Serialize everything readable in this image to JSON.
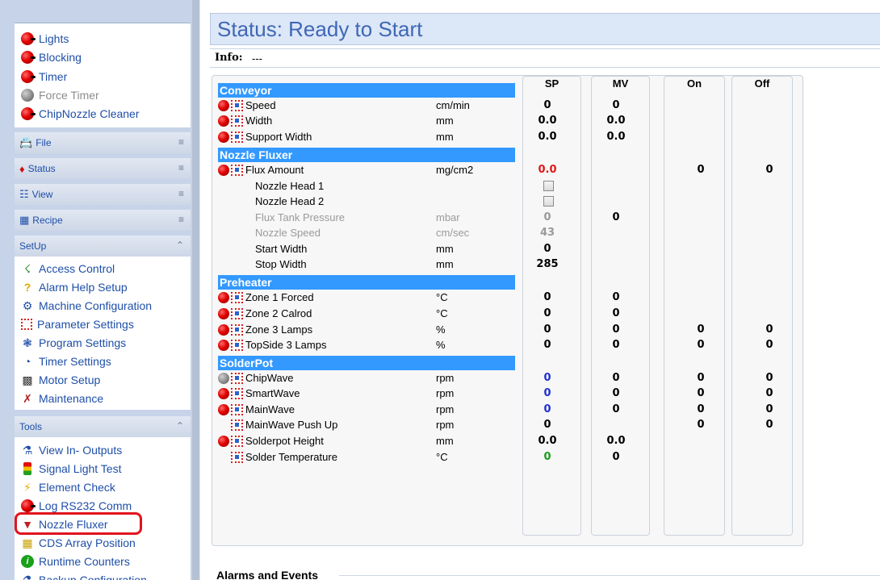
{
  "sidebar": {
    "top_items": [
      {
        "label": "Lights",
        "icon": "red-ball-icon",
        "enabled": true
      },
      {
        "label": "Blocking",
        "icon": "red-ball-icon",
        "enabled": true
      },
      {
        "label": "Timer",
        "icon": "red-ball-icon",
        "enabled": true
      },
      {
        "label": "Force Timer",
        "icon": "gray-ball-icon",
        "enabled": false
      },
      {
        "label": "ChipNozzle Cleaner",
        "icon": "red-ball-icon",
        "enabled": true
      }
    ],
    "groups": {
      "file": "File",
      "status": "Status",
      "view": "View",
      "recipe": "Recipe",
      "setup": "SetUp",
      "tools": "Tools"
    },
    "setup_items": [
      {
        "label": "Access Control",
        "icon": "key-people-icon"
      },
      {
        "label": "Alarm Help Setup",
        "icon": "question-icon"
      },
      {
        "label": "Machine Configuration",
        "icon": "machine-icon"
      },
      {
        "label": "Parameter Settings",
        "icon": "parameter-icon"
      },
      {
        "label": "Program Settings",
        "icon": "program-icon"
      },
      {
        "label": "Timer Settings",
        "icon": "clock-icon"
      },
      {
        "label": "Motor Setup",
        "icon": "motor-icon"
      },
      {
        "label": "Maintenance",
        "icon": "tools-icon"
      }
    ],
    "tools_items": [
      {
        "label": "View In- Outputs",
        "icon": "io-icon"
      },
      {
        "label": "Signal Light Test",
        "icon": "signal-light-icon"
      },
      {
        "label": "Element Check",
        "icon": "lightning-icon"
      },
      {
        "label": "Log RS232 Comm",
        "icon": "red-ball-icon"
      },
      {
        "label": "Nozzle Fluxer",
        "icon": "nozzle-icon"
      },
      {
        "label": "CDS Array Position",
        "icon": "grid-icon"
      },
      {
        "label": "Runtime Counters",
        "icon": "info-icon"
      },
      {
        "label": "Backup Configuration",
        "icon": "backup-icon"
      }
    ]
  },
  "status": {
    "title": "Status: Ready to Start"
  },
  "info": {
    "label": "Info:",
    "value": "---"
  },
  "columns": {
    "sp": "SP",
    "mv": "MV",
    "on": "On",
    "off": "Off"
  },
  "sections": {
    "conveyor": "Conveyor",
    "nozzle_fluxer": "Nozzle Fluxer",
    "preheater": "Preheater",
    "solderpot": "SolderPot"
  },
  "rows": {
    "speed": {
      "label": "Speed",
      "unit": "cm/min",
      "sp": "0",
      "mv": "0"
    },
    "width": {
      "label": "Width",
      "unit": "mm",
      "sp": "0.0",
      "mv": "0.0"
    },
    "support_width": {
      "label": "Support Width",
      "unit": "mm",
      "sp": "0.0",
      "mv": "0.0"
    },
    "flux_amount": {
      "label": "Flux Amount",
      "unit": "mg/cm2",
      "sp": "0.0",
      "on": "0",
      "off": "0"
    },
    "nozzle_head_1": {
      "label": "Nozzle Head 1"
    },
    "nozzle_head_2": {
      "label": "Nozzle Head 2"
    },
    "flux_tank_pressure": {
      "label": "Flux Tank Pressure",
      "unit": "mbar",
      "sp": "0",
      "mv": "0"
    },
    "nozzle_speed": {
      "label": "Nozzle Speed",
      "unit": "cm/sec",
      "sp": "43"
    },
    "start_width": {
      "label": "Start Width",
      "unit": "mm",
      "sp": "0"
    },
    "stop_width": {
      "label": "Stop Width",
      "unit": "mm",
      "sp": "285"
    },
    "zone1": {
      "label": "Zone 1 Forced",
      "unit": "°C",
      "sp": "0",
      "mv": "0"
    },
    "zone2": {
      "label": "Zone 2 Calrod",
      "unit": "°C",
      "sp": "0",
      "mv": "0"
    },
    "zone3": {
      "label": "Zone 3 Lamps",
      "unit": "%",
      "sp": "0",
      "mv": "0",
      "on": "0",
      "off": "0"
    },
    "topside3": {
      "label": "TopSide 3 Lamps",
      "unit": "%",
      "sp": "0",
      "mv": "0",
      "on": "0",
      "off": "0"
    },
    "chipwave": {
      "label": "ChipWave",
      "unit": "rpm",
      "sp": "0",
      "mv": "0",
      "on": "0",
      "off": "0"
    },
    "smartwave": {
      "label": "SmartWave",
      "unit": "rpm",
      "sp": "0",
      "mv": "0",
      "on": "0",
      "off": "0"
    },
    "mainwave": {
      "label": "MainWave",
      "unit": "rpm",
      "sp": "0",
      "mv": "0",
      "on": "0",
      "off": "0"
    },
    "mainwave_pushup": {
      "label": "MainWave Push Up",
      "unit": "rpm",
      "sp": "0",
      "on": "0",
      "off": "0"
    },
    "solderpot_height": {
      "label": "Solderpot Height",
      "unit": "mm",
      "sp": "0.0",
      "mv": "0.0"
    },
    "solder_temp": {
      "label": "Solder Temperature",
      "unit": "°C",
      "sp": "0",
      "mv": "0"
    }
  },
  "alarms": {
    "title": "Alarms and Events"
  },
  "colors": {
    "section_bar": "#3399ff",
    "status_title": "#3f67b5",
    "nav_text": "#1e4ea8",
    "highlight": "#e0141e"
  }
}
